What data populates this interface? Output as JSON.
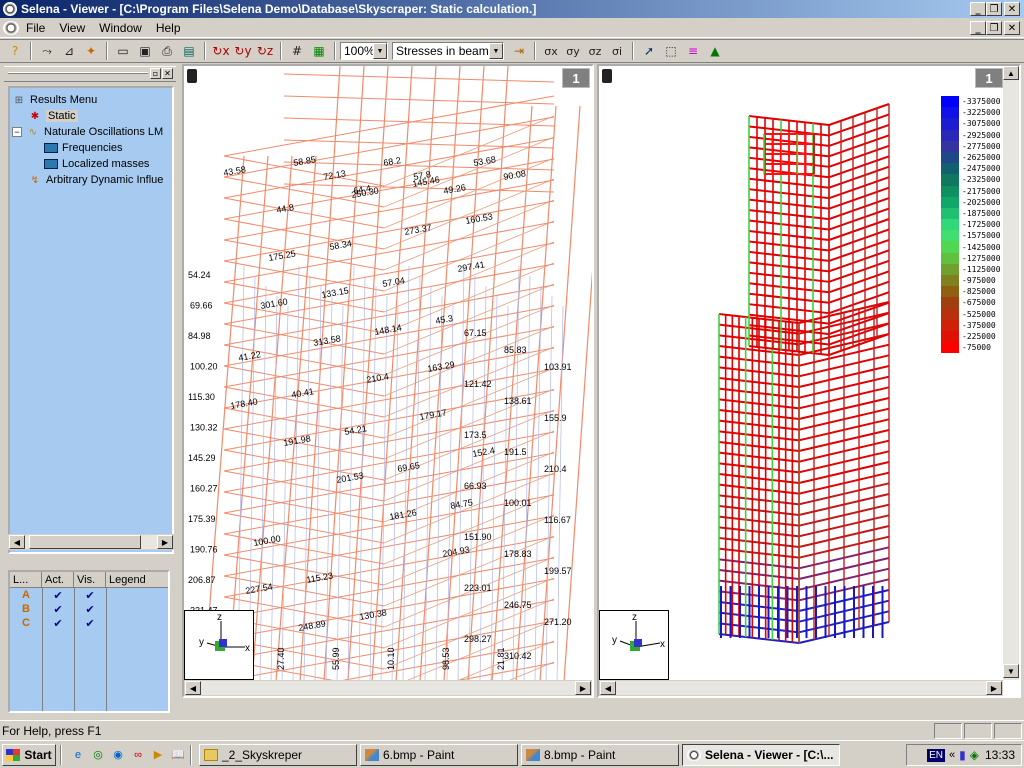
{
  "window": {
    "title": "Selena - Viewer - [C:\\Program Files\\Selena Demo\\Database\\Skyscraper:  Static calculation.]"
  },
  "menu": {
    "items": [
      "File",
      "View",
      "Window",
      "Help"
    ]
  },
  "toolbar": {
    "zoom": "100%",
    "result_type": "Stresses in beams",
    "icons": [
      "help-icon",
      "pointer-icon",
      "measure-icon",
      "wand-icon",
      "window1-icon",
      "window2-icon",
      "print-icon",
      "monitor-icon",
      "rotate-x-icon",
      "rotate-y-icon",
      "rotate-z-icon",
      "grid-icon",
      "grid-color-icon",
      "exit-icon",
      "sigma-x-icon",
      "sigma-y-icon",
      "sigma-z-icon",
      "sigma-i-icon",
      "select-icon",
      "rect-select-icon",
      "palette-icon",
      "color-scale-icon"
    ],
    "sigma_labels": [
      "σx",
      "σy",
      "σz",
      "σi"
    ]
  },
  "results_tree": {
    "items": [
      {
        "label": "Results Menu",
        "icon": "results-menu-icon",
        "selected": false
      },
      {
        "label": "Static",
        "icon": "static-icon",
        "selected": true
      },
      {
        "label": "Naturale Oscillations LM",
        "icon": "oscillations-icon",
        "selected": false
      },
      {
        "label": "Frequencies",
        "icon": "table-icon",
        "selected": false
      },
      {
        "label": "Localized masses",
        "icon": "table-icon",
        "selected": false
      },
      {
        "label": "Arbitrary Dynamic Influe",
        "icon": "dynamic-icon",
        "selected": false
      }
    ]
  },
  "layers": {
    "headers": [
      "L...",
      "Act.",
      "Vis.",
      "Legend"
    ],
    "rows": [
      {
        "name": "A",
        "active": "✔",
        "visible": "✔"
      },
      {
        "name": "B",
        "active": "✔",
        "visible": "✔"
      },
      {
        "name": "C",
        "active": "✔",
        "visible": "✔"
      }
    ]
  },
  "left_view": {
    "number": "1",
    "axes": {
      "x": "x",
      "y": "y",
      "z": "z"
    },
    "left_labels": [
      "54.24",
      "69.66",
      "84.98",
      "100.20",
      "115.30",
      "130.32",
      "145.29",
      "160.27",
      "175.39",
      "190.76",
      "206.87",
      "221.47"
    ],
    "inner_labels": [
      "43.58",
      "44.8",
      "58.34",
      "57.04",
      "45.3",
      "41.22",
      "40.41",
      "54.21",
      "69.65",
      "84.75",
      "100.00",
      "115.23",
      "130.38",
      "145.46",
      "160.53",
      "175.25",
      "133.15",
      "148.14",
      "163.29",
      "178.40",
      "191.98",
      "201.53",
      "181.26",
      "204.93",
      "227.54",
      "248.89",
      "250.30",
      "273.37",
      "297.41",
      "301.60",
      "313.58",
      "210.4",
      "179.17",
      "152.4"
    ],
    "right_labels": [
      "67.15",
      "85.83",
      "103.91",
      "121.42",
      "138.61",
      "155.9",
      "173.5",
      "191.5",
      "210.4",
      "66.93",
      "100.01",
      "116.67",
      "151.90",
      "178.83",
      "199.57",
      "223.01",
      "246.75",
      "271.20",
      "298.27",
      "310.42"
    ],
    "top_labels": [
      "58.85",
      "72.13",
      "64.4",
      "68.2",
      "57.8",
      "49.26",
      "53.68",
      "90.08"
    ],
    "bottom_labels": [
      "27.40",
      "55.99",
      "10.10",
      "98.53",
      "21.81"
    ]
  },
  "right_view": {
    "number": "1",
    "axes": {
      "x": "x",
      "y": "y",
      "z": "z"
    },
    "legend": [
      {
        "value": "-3375000",
        "color": "#0000ff"
      },
      {
        "value": "-3225000",
        "color": "#1010e8"
      },
      {
        "value": "-3075000",
        "color": "#1c1cd0"
      },
      {
        "value": "-2925000",
        "color": "#2a28b8"
      },
      {
        "value": "-2775000",
        "color": "#3433a0"
      },
      {
        "value": "-2625000",
        "color": "#204888"
      },
      {
        "value": "-2475000",
        "color": "#106070"
      },
      {
        "value": "-2325000",
        "color": "#107860"
      },
      {
        "value": "-2175000",
        "color": "#109060"
      },
      {
        "value": "-2025000",
        "color": "#10a868"
      },
      {
        "value": "-1875000",
        "color": "#20c070"
      },
      {
        "value": "-1725000",
        "color": "#30d878"
      },
      {
        "value": "-1575000",
        "color": "#40e070"
      },
      {
        "value": "-1425000",
        "color": "#50d850"
      },
      {
        "value": "-1275000",
        "color": "#60c040"
      },
      {
        "value": "-1125000",
        "color": "#70a030"
      },
      {
        "value": "-975000",
        "color": "#808020"
      },
      {
        "value": "-825000",
        "color": "#906010"
      },
      {
        "value": "-675000",
        "color": "#a04010"
      },
      {
        "value": "-525000",
        "color": "#b83010"
      },
      {
        "value": "-375000",
        "color": "#d02008"
      },
      {
        "value": "-225000",
        "color": "#e01008"
      },
      {
        "value": "-75000",
        "color": "#ff0000"
      }
    ]
  },
  "status": {
    "help": "For Help, press F1"
  },
  "taskbar": {
    "start": "Start",
    "tasks": [
      {
        "label": "_2_Skyskreper",
        "active": false
      },
      {
        "label": "6.bmp - Paint",
        "active": false
      },
      {
        "label": "8.bmp - Paint",
        "active": false
      },
      {
        "label": "Selena - Viewer - [C:\\...",
        "active": true
      }
    ],
    "lang": "EN",
    "clock": "13:33"
  }
}
